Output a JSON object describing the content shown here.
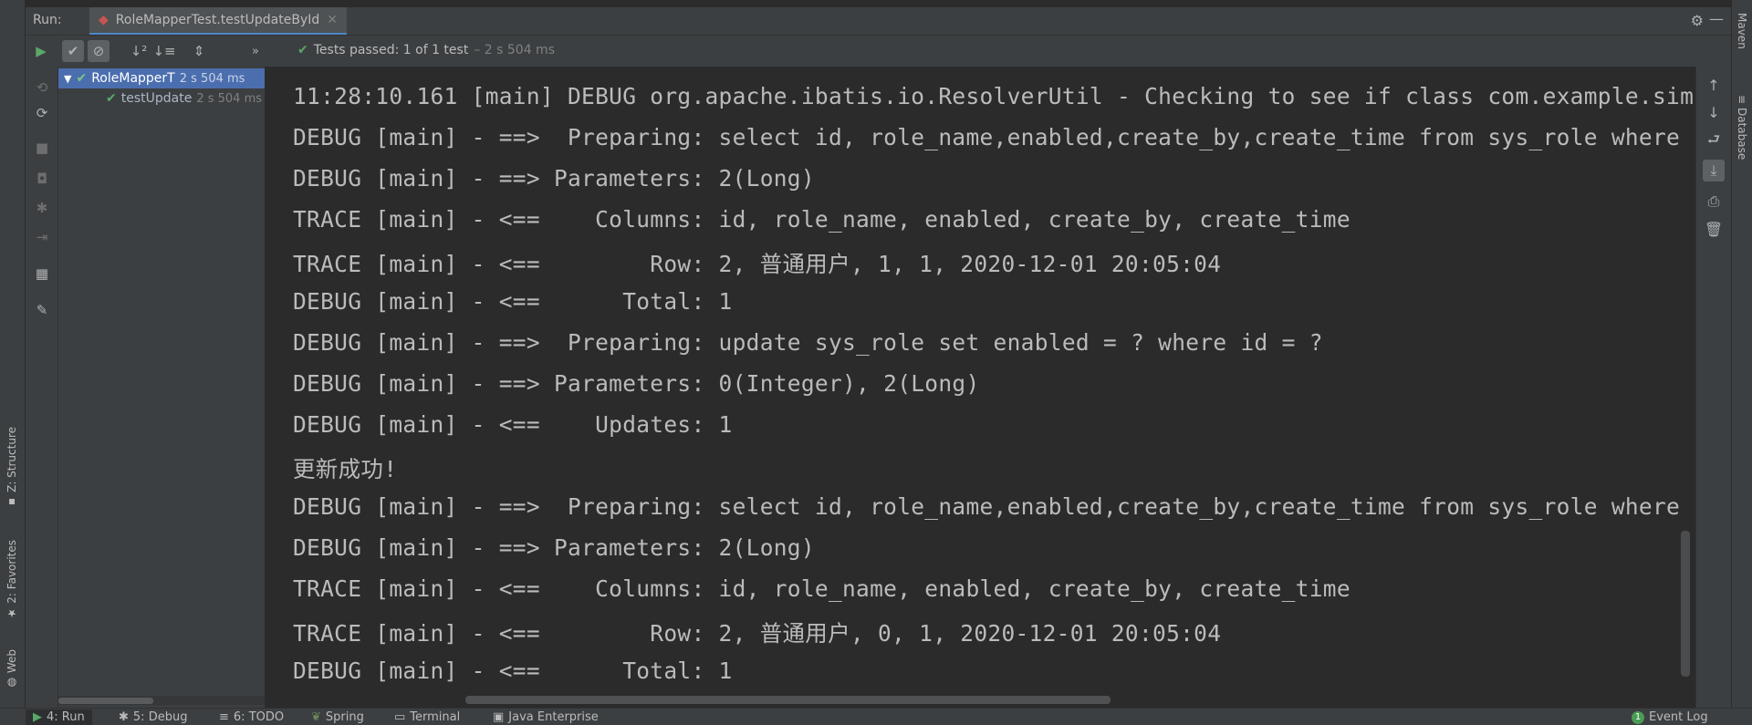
{
  "left_strip": {
    "structure": "Z: Structure",
    "favorites": "2: Favorites",
    "web": "Web"
  },
  "right_strip": {
    "maven": "Maven",
    "database": "Database"
  },
  "header": {
    "run_label": "Run:",
    "tab_title": "RoleMapperTest.testUpdateById"
  },
  "toolbar": {
    "status": "Tests passed: 1 of 1 test",
    "time": "– 2 s 504 ms"
  },
  "tree": {
    "root_label": "RoleMapperT",
    "root_time": "2 s 504 ms",
    "child_label": "testUpdate",
    "child_time": "2 s 504 ms"
  },
  "console": {
    "lines": [
      "11:28:10.161 [main] DEBUG org.apache.ibatis.io.ResolverUtil - Checking to see if class com.example.simp",
      "DEBUG [main] - ==>  Preparing: select id, role_name,enabled,create_by,create_time from sys_role where i",
      "DEBUG [main] - ==> Parameters: 2(Long)",
      "TRACE [main] - <==    Columns: id, role_name, enabled, create_by, create_time",
      "TRACE [main] - <==        Row: 2, 普通用户, 1, 1, 2020-12-01 20:05:04",
      "DEBUG [main] - <==      Total: 1",
      "DEBUG [main] - ==>  Preparing: update sys_role set enabled = ? where id = ?",
      "DEBUG [main] - ==> Parameters: 0(Integer), 2(Long)",
      "DEBUG [main] - <==    Updates: 1",
      "更新成功!",
      "DEBUG [main] - ==>  Preparing: select id, role_name,enabled,create_by,create_time from sys_role where i",
      "DEBUG [main] - ==> Parameters: 2(Long)",
      "TRACE [main] - <==    Columns: id, role_name, enabled, create_by, create_time",
      "TRACE [main] - <==        Row: 2, 普通用户, 0, 1, 2020-12-01 20:05:04",
      "DEBUG [main] - <==      Total: 1"
    ]
  },
  "bottombar": {
    "run": "4: Run",
    "debug": "5: Debug",
    "todo": "6: TODO",
    "spring": "Spring",
    "terminal": "Terminal",
    "java_enterprise": "Java Enterprise",
    "event_log_count": "1",
    "event_log": "Event Log"
  },
  "colors": {
    "background": "#2b2b2b",
    "panel": "#3c3f41",
    "selection": "#4b6eaf",
    "success": "#59a869",
    "text": "#bbbbbb"
  }
}
